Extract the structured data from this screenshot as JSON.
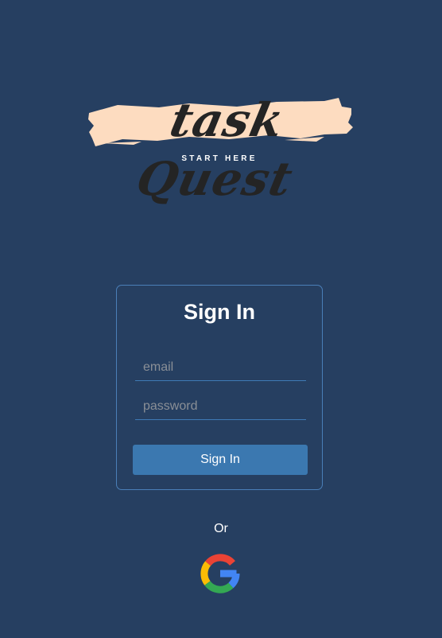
{
  "logo": {
    "wordmark": "task Quest",
    "tagline": "START HERE"
  },
  "signin_card": {
    "title": "Sign In",
    "email_placeholder": "email",
    "password_placeholder": "password",
    "submit_label": "Sign In"
  },
  "alt_login": {
    "or_text": "Or",
    "google_icon": "google-g-icon"
  },
  "colors": {
    "background": "#263f61",
    "card_border": "#4a7fb8",
    "button": "#3b78b0",
    "logo_brush": "#fddcc0"
  }
}
